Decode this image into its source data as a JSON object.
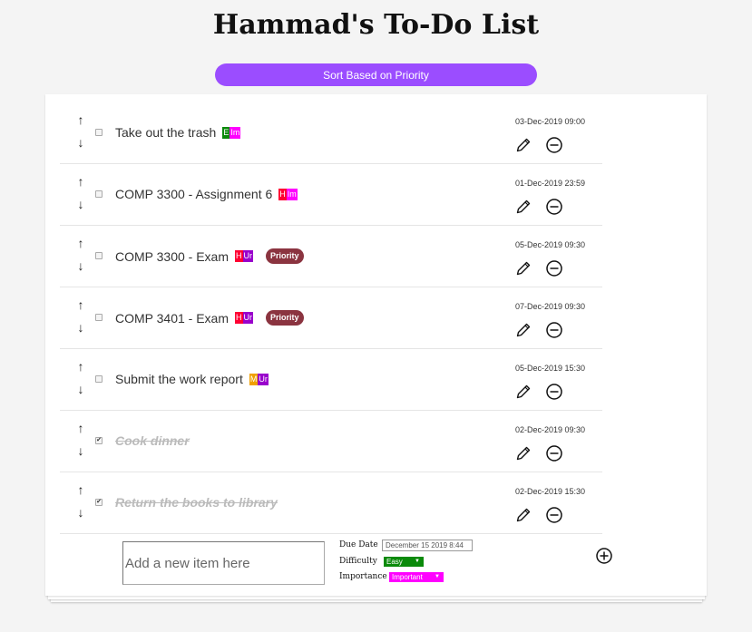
{
  "title": "Hammad's To-Do List",
  "sort_button": "Sort Based on Priority",
  "colors": {
    "accent": "#9b4dff",
    "easy": "#0a8a0a",
    "medium": "#f0a000",
    "hard": "#ff0033",
    "important": "#ff00ff",
    "urgent": "#9900cc",
    "priority": "#8b3440"
  },
  "tasks": [
    {
      "text": "Take out the trash",
      "diff": "E",
      "imp": "Im",
      "priority": "",
      "date": "03-Dec-2019 09:00",
      "done": false
    },
    {
      "text": "COMP 3300 - Assignment 6",
      "diff": "H",
      "imp": "Im",
      "priority": "",
      "date": "01-Dec-2019 23:59",
      "done": false
    },
    {
      "text": "COMP 3300 - Exam",
      "diff": "H",
      "imp": "Ur",
      "priority": "Priority",
      "date": "05-Dec-2019 09:30",
      "done": false
    },
    {
      "text": "COMP 3401 - Exam",
      "diff": "H",
      "imp": "Ur",
      "priority": "Priority",
      "date": "07-Dec-2019 09:30",
      "done": false
    },
    {
      "text": "Submit the work report",
      "diff": "M",
      "imp": "Ur",
      "priority": "",
      "date": "05-Dec-2019 15:30",
      "done": false
    },
    {
      "text": "Cook dinner",
      "diff": "",
      "imp": "",
      "priority": "",
      "date": "02-Dec-2019 09:30",
      "done": true
    },
    {
      "text": "Return the books to library",
      "diff": "",
      "imp": "",
      "priority": "",
      "date": "02-Dec-2019 15:30",
      "done": true
    }
  ],
  "icons": {
    "up": "arrow-up-icon",
    "down": "arrow-down-icon",
    "edit": "pencil-icon",
    "remove": "minus-circle-icon",
    "add": "plus-circle-icon",
    "check": "✔"
  },
  "new_item": {
    "placeholder": "Add a new item here",
    "due_label": "Due Date",
    "due_value": "December 15 2019 8:44",
    "difficulty_label": "Difficulty",
    "difficulty_value": "Easy",
    "importance_label": "Importance",
    "importance_value": "Important"
  }
}
